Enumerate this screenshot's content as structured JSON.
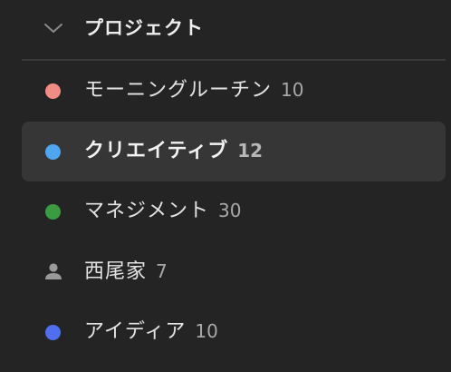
{
  "section": {
    "title": "プロジェクト",
    "expand_icon": "chevron-down-icon"
  },
  "projects": [
    {
      "name": "モーニングルーチン",
      "count": "10",
      "color": "#f08c84",
      "icon": "dot-icon",
      "selected": false
    },
    {
      "name": "クリエイティブ",
      "count": "12",
      "color": "#4fa6f0",
      "icon": "dot-icon",
      "selected": true
    },
    {
      "name": "マネジメント",
      "count": "30",
      "color": "#3b9b41",
      "icon": "dot-icon",
      "selected": false
    },
    {
      "name": "西尾家",
      "count": "7",
      "color": "#9a9a9a",
      "icon": "person-icon",
      "selected": false
    },
    {
      "name": "アイディア",
      "count": "10",
      "color": "#4f6ff0",
      "icon": "dot-icon",
      "selected": false
    }
  ]
}
